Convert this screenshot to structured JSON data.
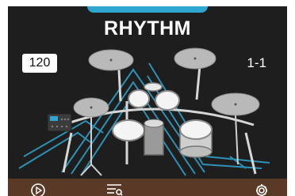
{
  "screen": {
    "title": "RHYTHM",
    "tempo": "120",
    "measure": "1-1"
  },
  "kit": {
    "image": "electronic-drum-kit",
    "cymbal_color": "#b9b9b9",
    "drum_head_color": "#f4f4f4",
    "glow_color": "#2fa6cf"
  },
  "footer": {
    "play": "play-icon",
    "list": "playlist-icon",
    "settings": "settings-icon"
  }
}
